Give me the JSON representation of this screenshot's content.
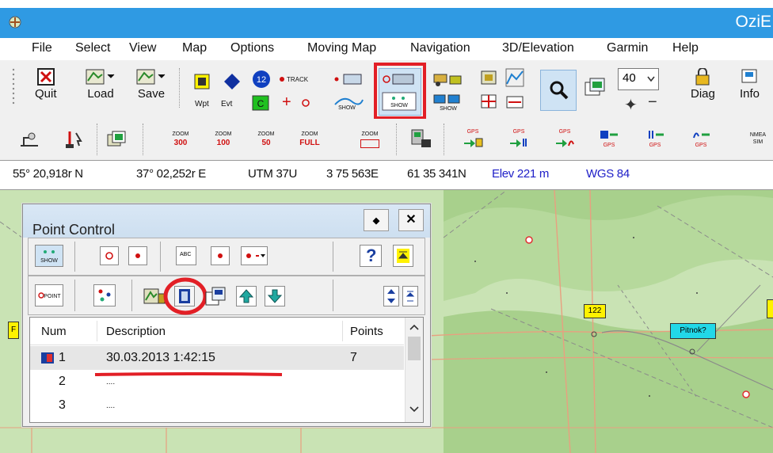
{
  "window": {
    "title": "OziE",
    "menu": [
      "File",
      "Select",
      "View",
      "Map",
      "Options",
      "Moving Map",
      "Navigation",
      "3D/Elevation",
      "Garmin",
      "Help"
    ]
  },
  "toolbar1": {
    "quit": "Quit",
    "load": "Load",
    "save": "Save",
    "wpt": "Wpt",
    "evt": "Evt",
    "track_tag": "TRACK",
    "show_tag": "SHOW",
    "zoom_value": "40",
    "diag": "Diag",
    "info": "Info",
    "l_glyph": "L"
  },
  "toolbar2": {
    "zoom_labels": [
      [
        "ZOOM",
        "300"
      ],
      [
        "ZOOM",
        "100"
      ],
      [
        "ZOOM",
        "50"
      ],
      [
        "ZOOM",
        "FULL"
      ],
      [
        "ZOOM",
        ""
      ]
    ],
    "gps_tag": "GPS",
    "nmea_tag": "NMEA SIM"
  },
  "status": {
    "lat": "55° 20,918r N",
    "lon": "37° 02,252r E",
    "utm_zone": "UTM 37U",
    "easting": "3 75 563E",
    "northing": "61 35 341N",
    "elev": "Elev 221 m",
    "datum": "WGS 84"
  },
  "map": {
    "label_122": "122",
    "label_pitnok": "Pitnok?",
    "label_f": "F"
  },
  "point_control": {
    "title": "Point Control",
    "pin_glyph": "◆",
    "close_glyph": "✕",
    "show_tag": "SHOW",
    "abc_tag": "ABC",
    "point_tag": "POINT",
    "help_glyph": "?",
    "columns": {
      "num": "Num",
      "desc": "Description",
      "points": "Points"
    },
    "rows": [
      {
        "num": "1",
        "desc": "30.03.2013 1:42:15",
        "points": "7"
      },
      {
        "num": "2",
        "desc": "....",
        "points": ""
      },
      {
        "num": "3",
        "desc": "....",
        "points": ""
      }
    ]
  },
  "colors": {
    "titlebar": "#2f9ae3",
    "map_green": "#c9e3b4",
    "map_dark_green": "#a8d08c",
    "highlight_red": "#e21f26",
    "track_orange": "#e8a080",
    "waypoint_yellow": "#fff200",
    "waypoint_cyan": "#22d8e8"
  }
}
